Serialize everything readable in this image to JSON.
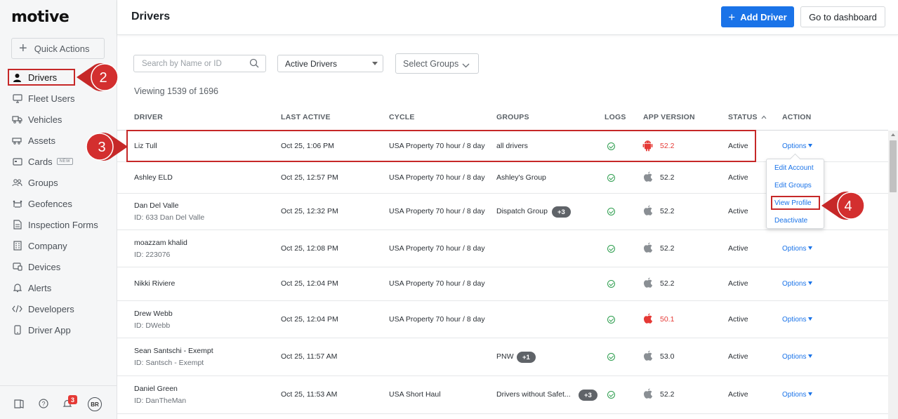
{
  "app": {
    "logo": "motive"
  },
  "sidebar": {
    "quick_actions": "Quick Actions",
    "items": [
      {
        "label": "Drivers",
        "icon": "person-icon"
      },
      {
        "label": "Fleet Users",
        "icon": "monitor-icon"
      },
      {
        "label": "Vehicles",
        "icon": "truck-icon"
      },
      {
        "label": "Assets",
        "icon": "trailer-icon"
      },
      {
        "label": "Cards",
        "icon": "card-icon",
        "badge": "NEW"
      },
      {
        "label": "Groups",
        "icon": "groups-icon"
      },
      {
        "label": "Geofences",
        "icon": "geofence-icon"
      },
      {
        "label": "Inspection Forms",
        "icon": "form-icon"
      },
      {
        "label": "Company",
        "icon": "building-icon"
      },
      {
        "label": "Devices",
        "icon": "devices-icon"
      },
      {
        "label": "Alerts",
        "icon": "bell-icon"
      },
      {
        "label": "Developers",
        "icon": "code-icon"
      },
      {
        "label": "Driver App",
        "icon": "phone-icon"
      }
    ],
    "notification_count": "3",
    "avatar_initials": "BR"
  },
  "header": {
    "title": "Drivers",
    "add_driver": "Add Driver",
    "go_to_dashboard": "Go to dashboard"
  },
  "filters": {
    "search_placeholder": "Search by Name or ID",
    "status_select": "Active Drivers",
    "groups_select": "Select Groups"
  },
  "viewing": "Viewing 1539 of 1696",
  "table": {
    "columns": [
      "DRIVER",
      "LAST ACTIVE",
      "CYCLE",
      "GROUPS",
      "LOGS",
      "APP VERSION",
      "STATUS",
      "ACTION"
    ],
    "rows": [
      {
        "name": "Liz Tull",
        "id": "",
        "last_active": "Oct 25, 1:06 PM",
        "cycle": "USA Property 70 hour / 8 day",
        "groups": "all drivers",
        "extra": "",
        "platform": "android",
        "version": "52.2",
        "version_warn": true,
        "status": "Active",
        "action": "Options"
      },
      {
        "name": "Ashley ELD",
        "id": "",
        "last_active": "Oct 25, 12:57 PM",
        "cycle": "USA Property 70 hour / 8 day",
        "groups": "Ashley's Group",
        "extra": "",
        "platform": "apple",
        "version": "52.2",
        "version_warn": false,
        "status": "Active",
        "action": ""
      },
      {
        "name": "Dan Del Valle",
        "id": "ID: 633 Dan Del Valle",
        "last_active": "Oct 25, 12:32 PM",
        "cycle": "USA Property 70 hour / 8 day",
        "groups": "Dispatch Group",
        "extra": "+3",
        "platform": "apple",
        "version": "52.2",
        "version_warn": false,
        "status": "Active",
        "action": ""
      },
      {
        "name": "moazzam khalid",
        "id": "ID: 223076",
        "last_active": "Oct 25, 12:08 PM",
        "cycle": "USA Property 70 hour / 8 day",
        "groups": "",
        "extra": "",
        "platform": "apple",
        "version": "52.2",
        "version_warn": false,
        "status": "Active",
        "action": "Options"
      },
      {
        "name": "Nikki Riviere",
        "id": "",
        "last_active": "Oct 25, 12:04 PM",
        "cycle": "USA Property 70 hour / 8 day",
        "groups": "",
        "extra": "",
        "platform": "apple",
        "version": "52.2",
        "version_warn": false,
        "status": "Active",
        "action": "Options"
      },
      {
        "name": "Drew Webb",
        "id": "ID: DWebb",
        "last_active": "Oct 25, 12:04 PM",
        "cycle": "USA Property 70 hour / 8 day",
        "groups": "",
        "extra": "",
        "platform": "apple",
        "version": "50.1",
        "version_warn": true,
        "status": "Active",
        "action": "Options"
      },
      {
        "name": "Sean Santschi - Exempt",
        "id": "ID: Santsch - Exempt",
        "last_active": "Oct 25, 11:57 AM",
        "cycle": "",
        "groups": "PNW",
        "extra": "+1",
        "platform": "apple",
        "version": "53.0",
        "version_warn": false,
        "status": "Active",
        "action": "Options"
      },
      {
        "name": "Daniel Green",
        "id": "ID: DanTheMan",
        "last_active": "Oct 25, 11:53 AM",
        "cycle": "USA Short Haul",
        "groups": "Drivers without Safet...",
        "extra": "+3",
        "platform": "apple",
        "version": "52.2",
        "version_warn": false,
        "status": "Active",
        "action": "Options"
      }
    ]
  },
  "dropdown": {
    "items": [
      "Edit Account",
      "Edit Groups",
      "View Profile",
      "Deactivate"
    ]
  },
  "annotations": {
    "step_sidebar": "2",
    "step_row": "3",
    "step_menu": "4"
  },
  "colors": {
    "accent": "#1a73e8",
    "annotation_red": "#c62828",
    "warning_red": "#e53935",
    "ok_green": "#2e9e4f"
  }
}
